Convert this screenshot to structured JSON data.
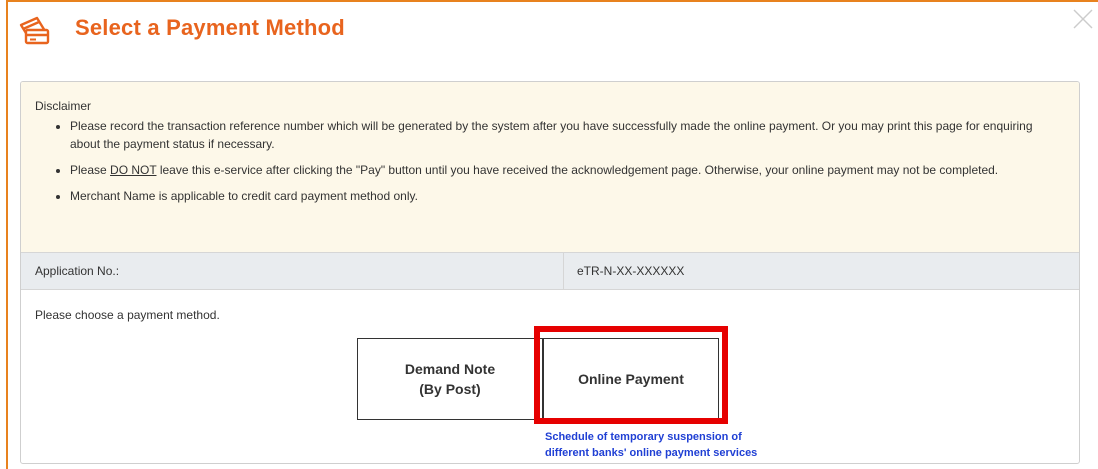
{
  "dialog": {
    "title": "Select a Payment Method",
    "icon": "payment-card-icon",
    "close_icon": "close-icon",
    "accent_color": "#e8641e"
  },
  "disclaimer": {
    "heading": "Disclaimer",
    "item1": "Please record the transaction reference number which will be generated by the system after you have successfully made the online payment. Or you may print this page for enquiring about the payment status if necessary.",
    "item2_prefix": "Please ",
    "item2_emphasis": "DO NOT",
    "item2_suffix": " leave this e-service after clicking the \"Pay\" button until you have received the acknowledgement page. Otherwise, your online payment may not be completed.",
    "item3": "Merchant Name is applicable to credit card payment method only."
  },
  "application": {
    "label": "Application No.:",
    "value": "eTR-N-XX-XXXXXX"
  },
  "payment": {
    "prompt": "Please choose a payment method.",
    "demand_note_line1": "Demand Note",
    "demand_note_line2": "(By Post)",
    "online_payment": "Online Payment",
    "schedule_line1": "Schedule of temporary suspension of",
    "schedule_line2": "different banks' online payment services",
    "highlight_color": "#e60000",
    "link_color": "#1f3fd4"
  }
}
